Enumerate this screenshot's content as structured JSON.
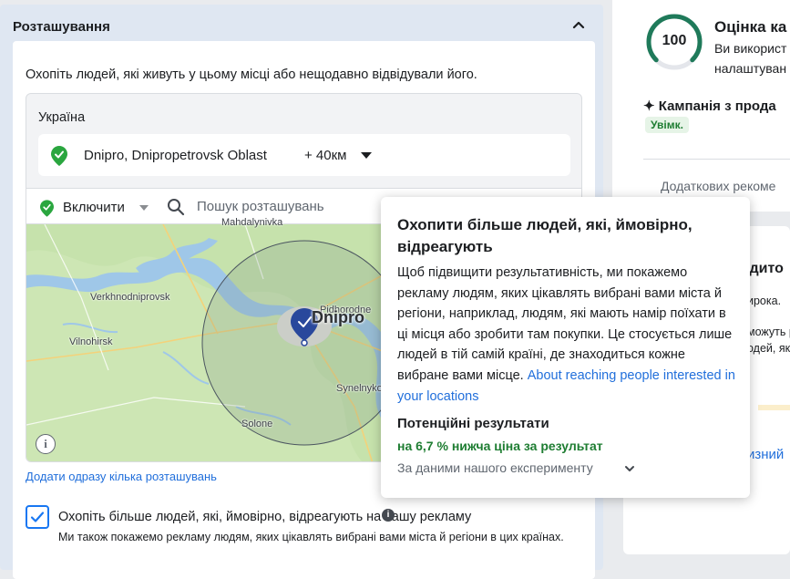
{
  "location_section": {
    "title": "Розташування",
    "intro": "Охопіть людей, які живуть у цьому місці або нещодавно відвідували його.",
    "country": "Україна",
    "selected_location": {
      "name": "Dnipro, Dnipropetrovsk Oblast",
      "radius": "+ 40км"
    },
    "include_dropdown": "Включити",
    "search_placeholder": "Пошук розташувань",
    "map_labels": {
      "city": "Dnipro",
      "verkhnodniprovsk": "Verkhnodniprovsk",
      "vilnohirsk": "Vilnohirsk",
      "pidhorodne": "Pidhorodne",
      "synelnykove": "Synelnykove",
      "solone": "Solone",
      "mahdalynivka": "Mahdalynivka"
    },
    "bulk_add_link": "Додати одразу кілька розташувань",
    "reach_more": {
      "checked": true,
      "label": "Охопіть більше людей, які, ймовірно, відреагують на вашу рекламу",
      "sublabel": "Ми також покажемо рекламу людям, яких цікавлять вибрані вами міста й регіони в цих країнах."
    }
  },
  "tooltip": {
    "title": "Охопити більше людей, які, ймовірно, відреагують",
    "body": "Щоб підвищити результативність, ми покажемо рекламу людям, яких цікавлять вибрані вами міста й регіони, наприклад, людям, які мають намір поїхати в ці місця або зробити там покупки. Це стосується лише людей в тій самій країні, де знаходиться кожне вибране вами місце.",
    "link": "About reaching people interested in your locations",
    "results_title": "Потенційні результати",
    "metric": "на 6,7 % нижча ціна за результат",
    "source": "За даними нашого експерименту"
  },
  "right_panel": {
    "score": "100",
    "score_fraction": 1.0,
    "score_title": "Оцінка ка",
    "score_desc_1": "Ви використ",
    "score_desc_2": "налаштуван",
    "campaign_title": "Кампанія з прода",
    "campaign_status": "Увімк.",
    "more_recommendations": "Додаткових рекоме",
    "card_fragments": {
      "heading": "удито",
      "line1": "ирока.",
      "line2": "можуть рек",
      "line3": "одей, які",
      "link": "изний"
    }
  },
  "colors": {
    "accent_blue": "#1877f2",
    "link_blue": "#216fdb",
    "success_green": "#1e7d32",
    "panel_bg": "#dfe7f2"
  }
}
